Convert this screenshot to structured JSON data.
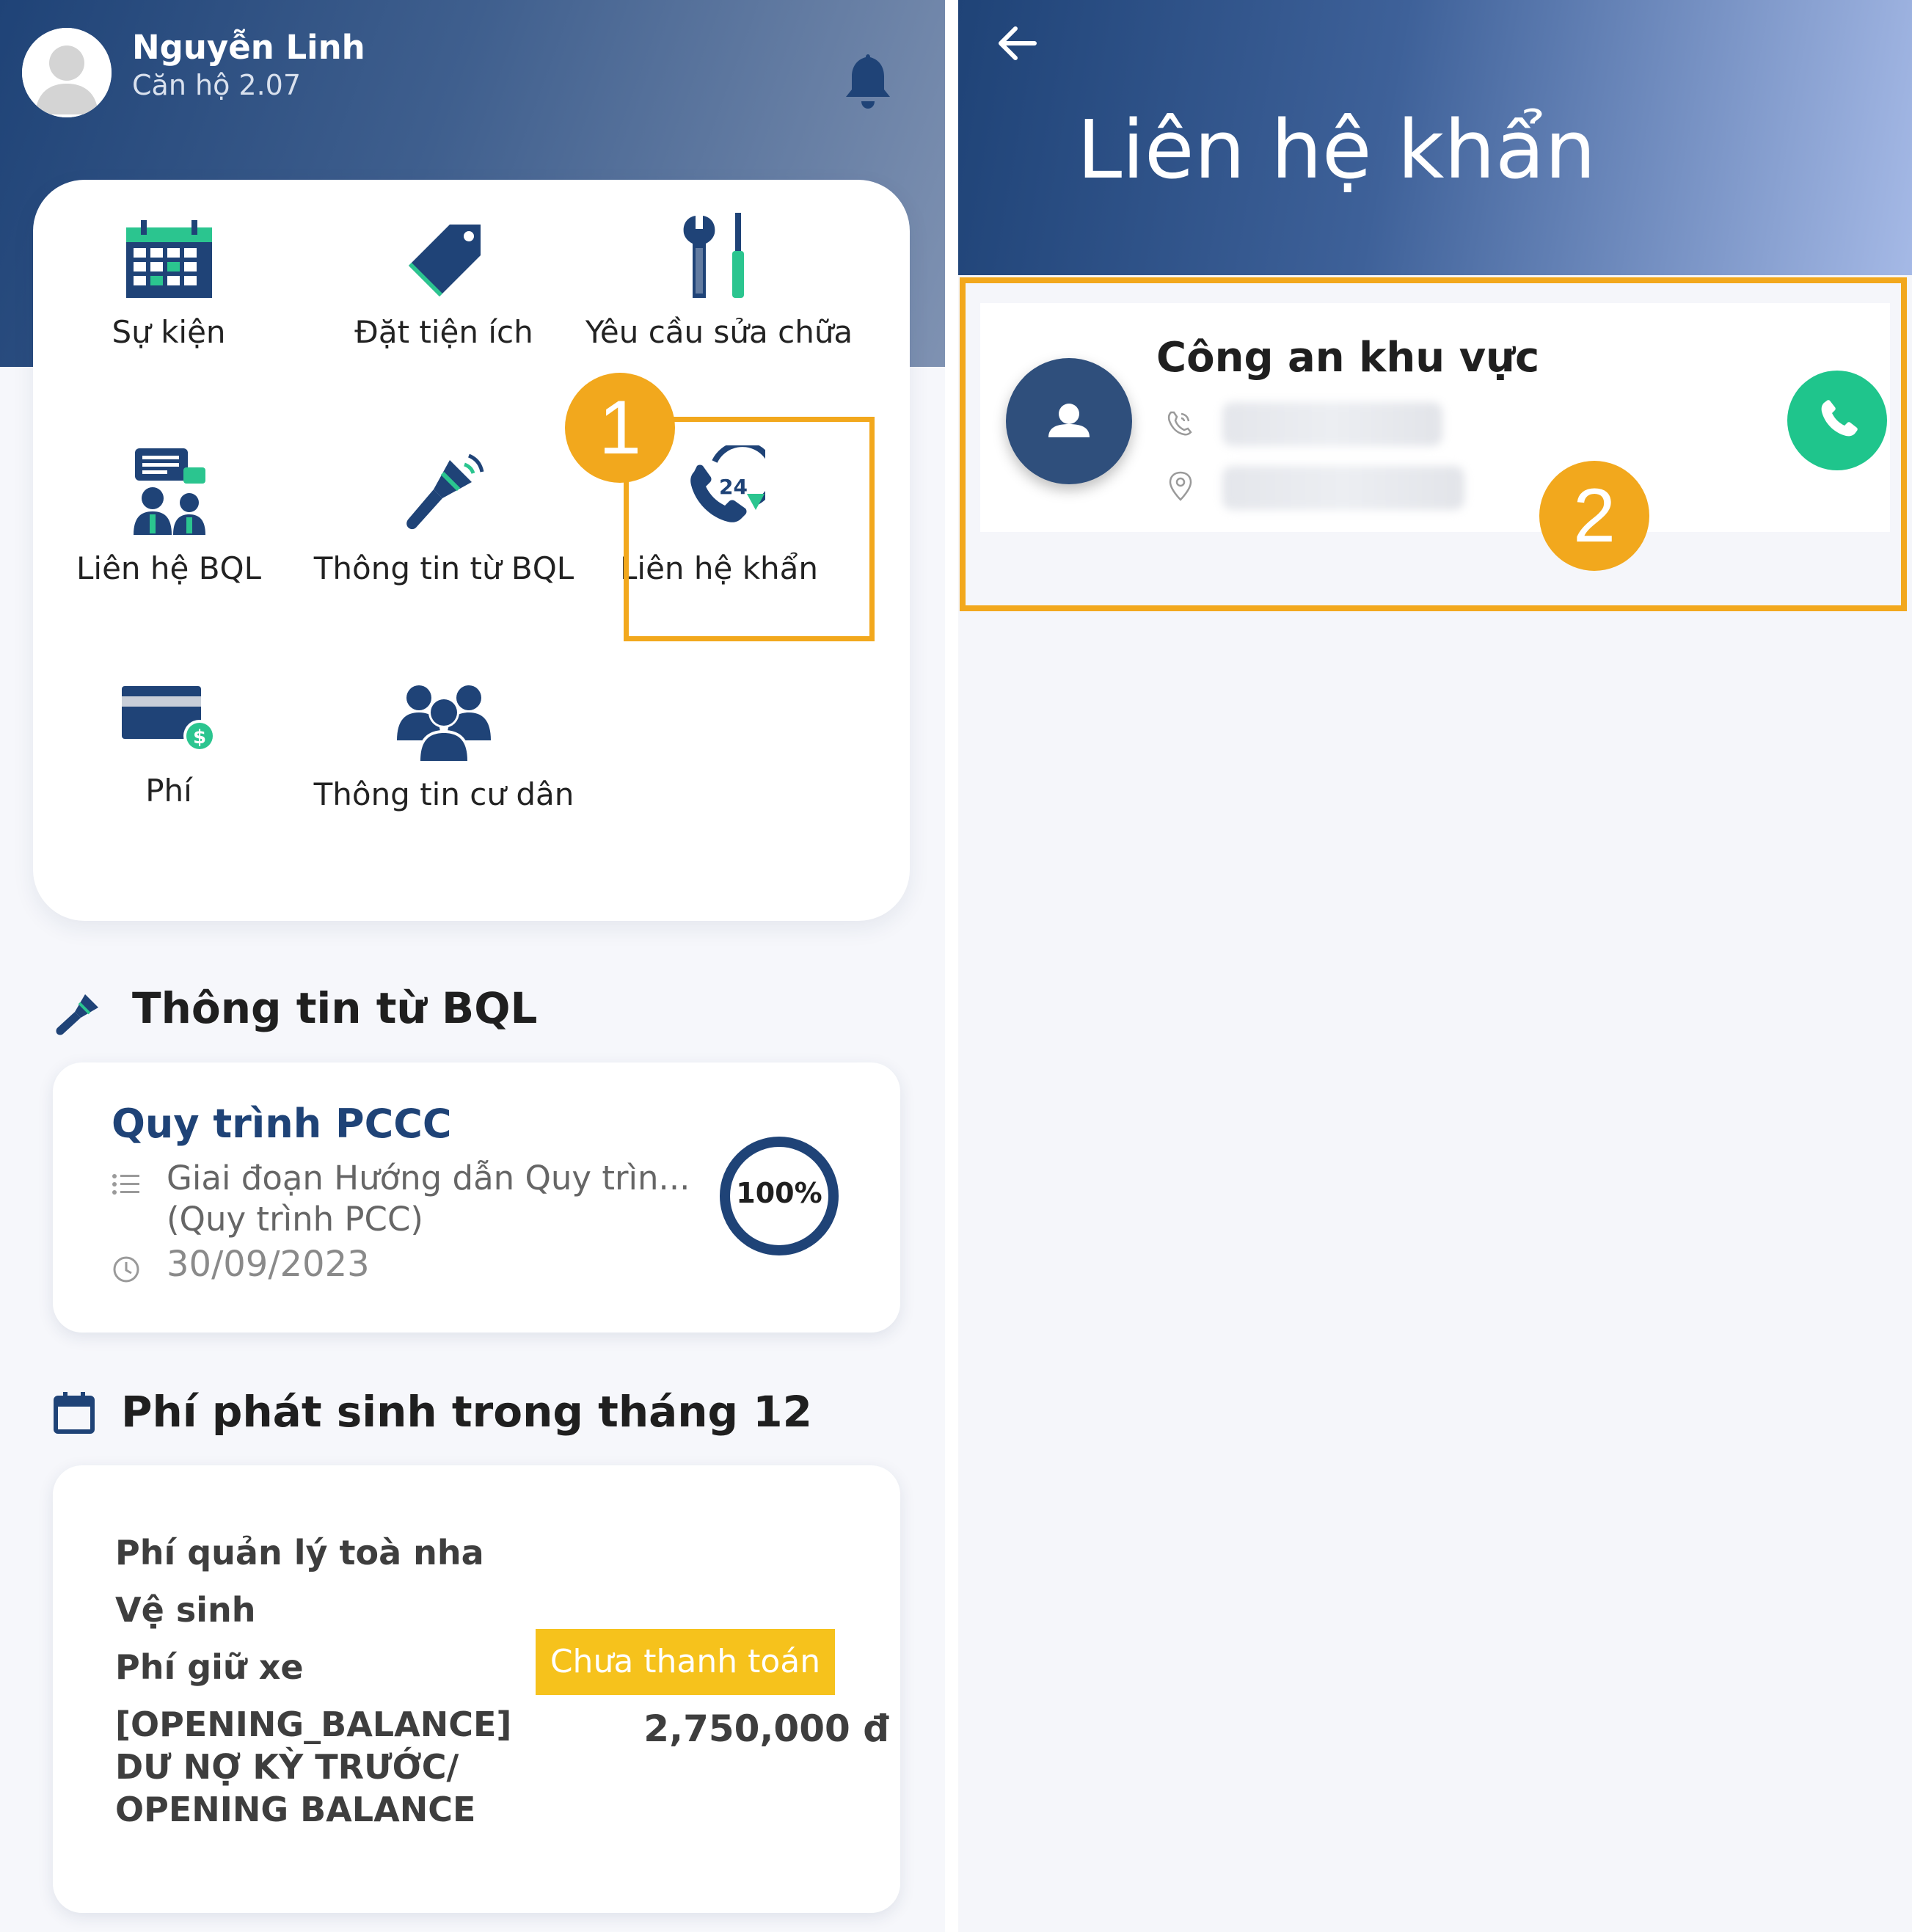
{
  "left_screen": {
    "user": {
      "name": "Nguyễn Linh",
      "apartment": "Căn hộ 2.07"
    },
    "menu": [
      {
        "label": "Sự kiện",
        "icon": "calendar-icon"
      },
      {
        "label": "Đặt tiện ích",
        "icon": "tag-icon"
      },
      {
        "label": "Yêu cầu sửa chữa",
        "icon": "tools-icon"
      },
      {
        "label": "Liên hệ BQL",
        "icon": "meeting-chat-icon"
      },
      {
        "label": "Thông tin từ BQL",
        "icon": "megaphone-icon"
      },
      {
        "label": "Liên hệ khẩn",
        "icon": "phone-24h-icon"
      },
      {
        "label": "Phí",
        "icon": "credit-card-icon"
      },
      {
        "label": "Thông tin cư dân",
        "icon": "people-group-icon"
      }
    ],
    "news_section": {
      "title": "Thông tin từ BQL",
      "card": {
        "title": "Quy trình PCCC",
        "description": "Giai đoạn Hướng dẫn Quy trìn... (Quy trình PCC)",
        "date": "30/09/2023",
        "progress_label": "100%",
        "progress": 1.0
      }
    },
    "fee_section": {
      "title": "Phí phát sinh trong tháng 12",
      "items": [
        "Phí quản lý toà nha",
        "Vệ sinh",
        "Phí giữ xe",
        "[OPENING_BALANCE] DƯ NỢ KỲ TRƯỚC/ OPENING BALANCE"
      ],
      "status": "Chưa thanh toán",
      "amount": "2,750,000 đ"
    }
  },
  "right_screen": {
    "title": "Liên hệ khẩn",
    "contact": {
      "name": "Công an khu vực"
    }
  },
  "annotations": {
    "step1": "1",
    "step2": "2"
  },
  "colors": {
    "primary": "#1f4377",
    "accent_green": "#1fc58c",
    "highlight": "#f2a81d",
    "status_yellow": "#f6c21c"
  }
}
